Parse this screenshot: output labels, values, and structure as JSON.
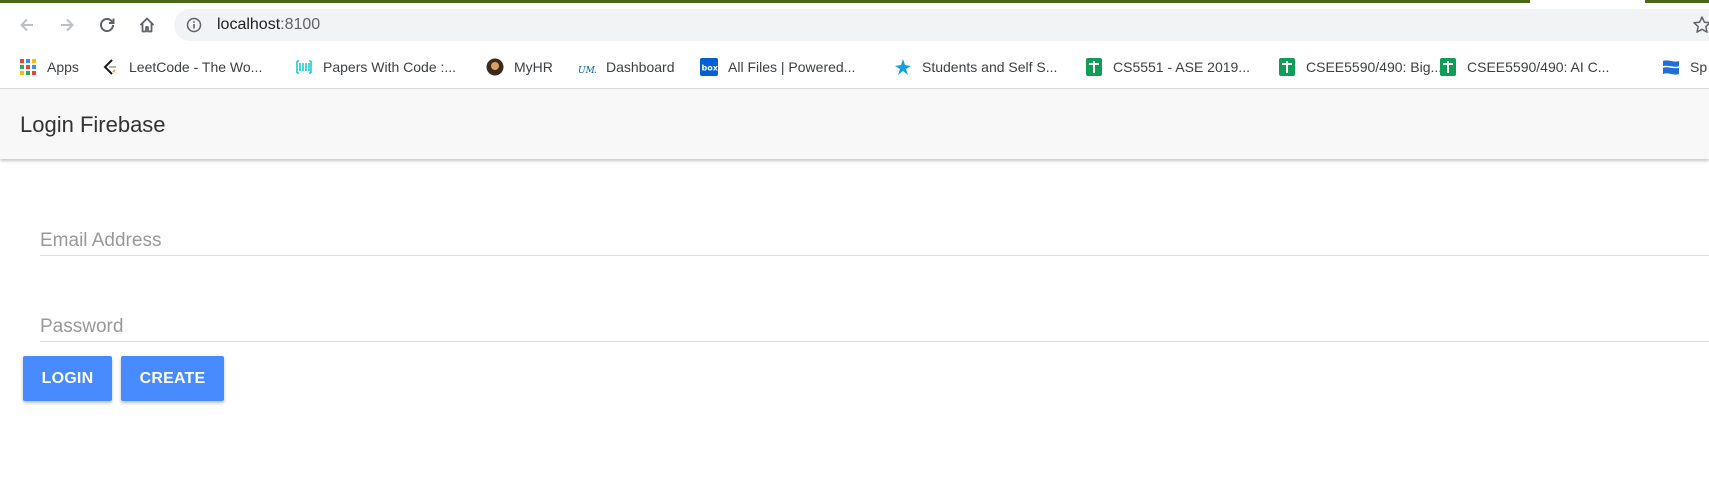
{
  "browser": {
    "url_host": "localhost",
    "url_port": ":8100",
    "bookmarks": [
      {
        "label": "Apps",
        "icon": "apps-grid-icon"
      },
      {
        "label": "LeetCode - The Wo...",
        "icon": "leetcode-icon"
      },
      {
        "label": "Papers With Code :...",
        "icon": "paperswithcode-icon"
      },
      {
        "label": "MyHR",
        "icon": "myhr-icon"
      },
      {
        "label": "Dashboard",
        "icon": "umkc-icon"
      },
      {
        "label": "All Files | Powered...",
        "icon": "box-icon"
      },
      {
        "label": "Students and Self S...",
        "icon": "star-burst-icon"
      },
      {
        "label": "CS5551 - ASE 2019...",
        "icon": "sheets-icon"
      },
      {
        "label": "CSEE5590/490: Big...",
        "icon": "sheets-icon"
      },
      {
        "label": "CSEE5590/490: AI C...",
        "icon": "sheets-icon"
      },
      {
        "label": "Sp",
        "icon": "flag-icon"
      }
    ]
  },
  "app": {
    "title": "Login Firebase",
    "email_placeholder": "Email Address",
    "email_value": "",
    "password_placeholder": "Password",
    "password_value": "",
    "login_label": "LOGIN",
    "create_label": "CREATE"
  },
  "colors": {
    "accent": "#488aff",
    "header_bg": "#f8f8f8",
    "top_stripe": "#4a6619"
  }
}
